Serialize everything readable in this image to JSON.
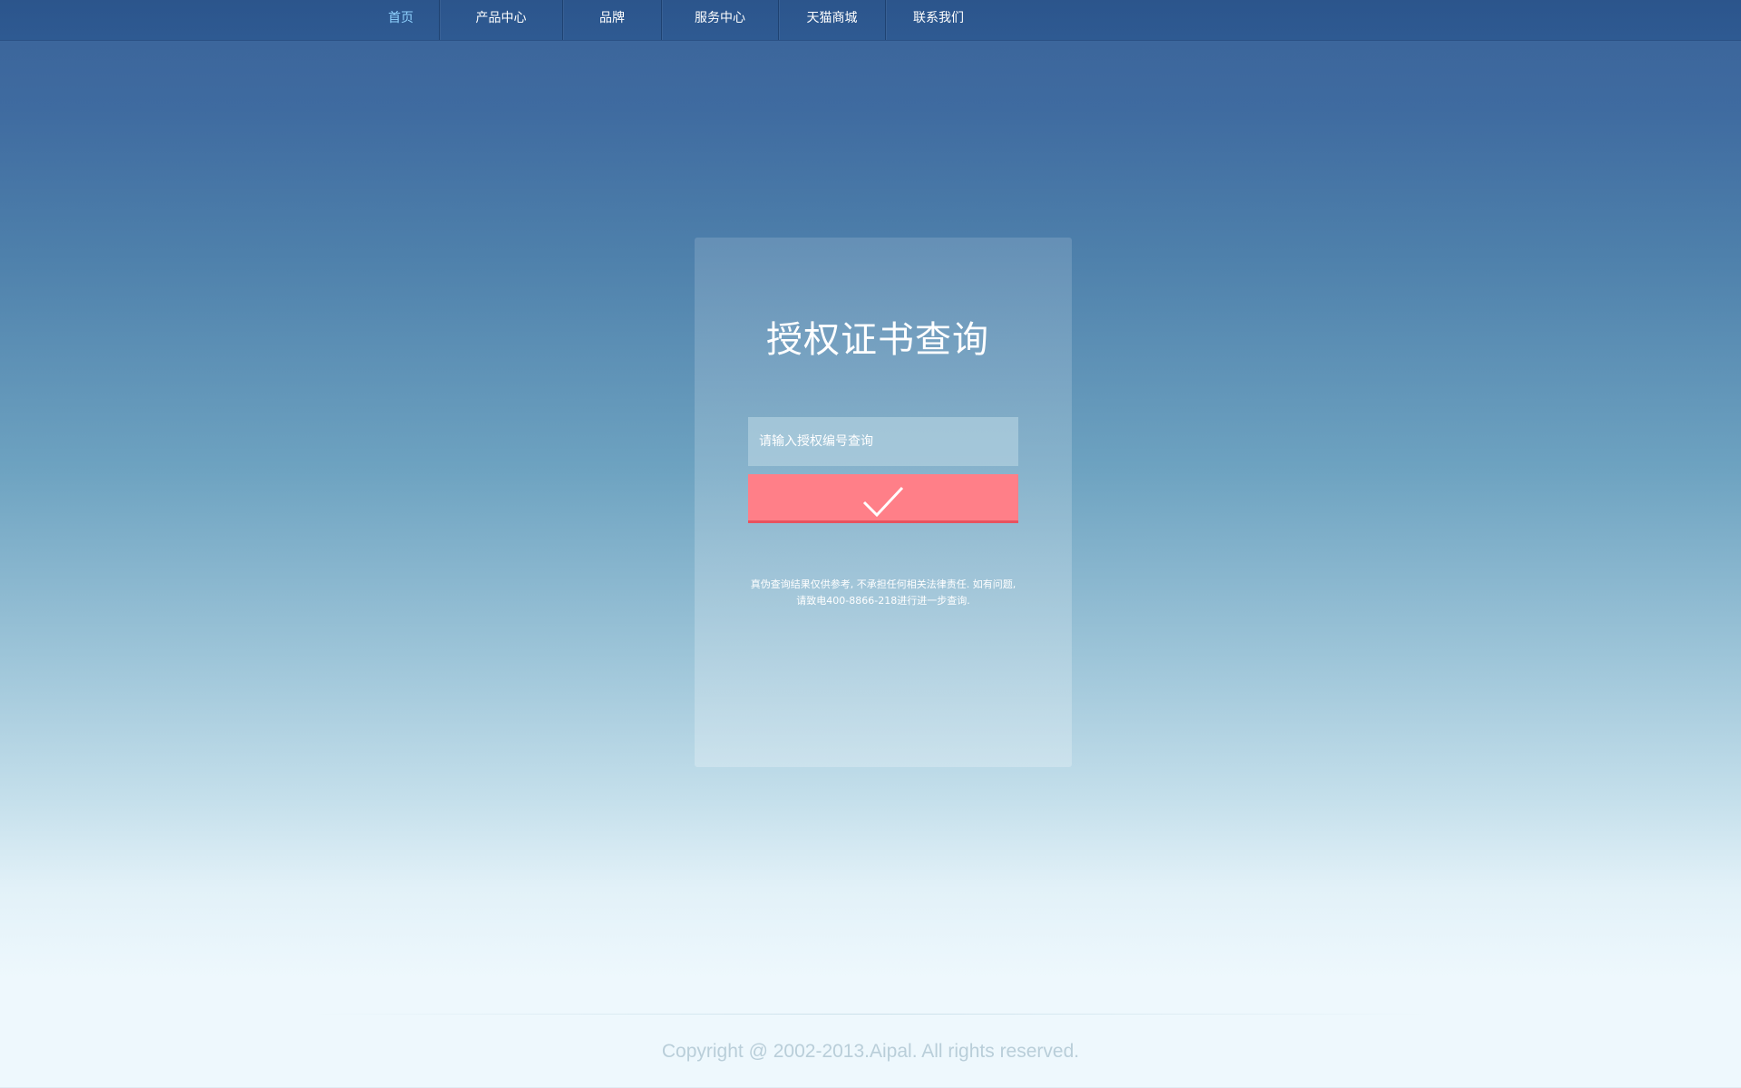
{
  "nav": {
    "items": [
      {
        "label": "首页",
        "active": true
      },
      {
        "label": "产品中心",
        "active": false
      },
      {
        "label": "品牌",
        "active": false
      },
      {
        "label": "服务中心",
        "active": false
      },
      {
        "label": "天猫商城",
        "active": false
      },
      {
        "label": "联系我们",
        "active": false
      }
    ]
  },
  "query": {
    "title": "授权证书查询",
    "input_placeholder": "请输入授权编号查询",
    "input_value": "",
    "submit_icon": "checkmark-icon",
    "note_line1": "真伪查询结果仅供参考, 不承担任何相关法律责任. 如有问题,",
    "note_line2": "请致电400-8866-218进行进一步查询."
  },
  "footer": {
    "copyright": "Copyright @ 2002-2013.Aipal. All rights reserved."
  },
  "colors": {
    "nav_background": "#2c558c",
    "nav_active_text": "#8fd2ff",
    "submit_button": "#ff7f88",
    "submit_button_border": "#e8535f"
  }
}
